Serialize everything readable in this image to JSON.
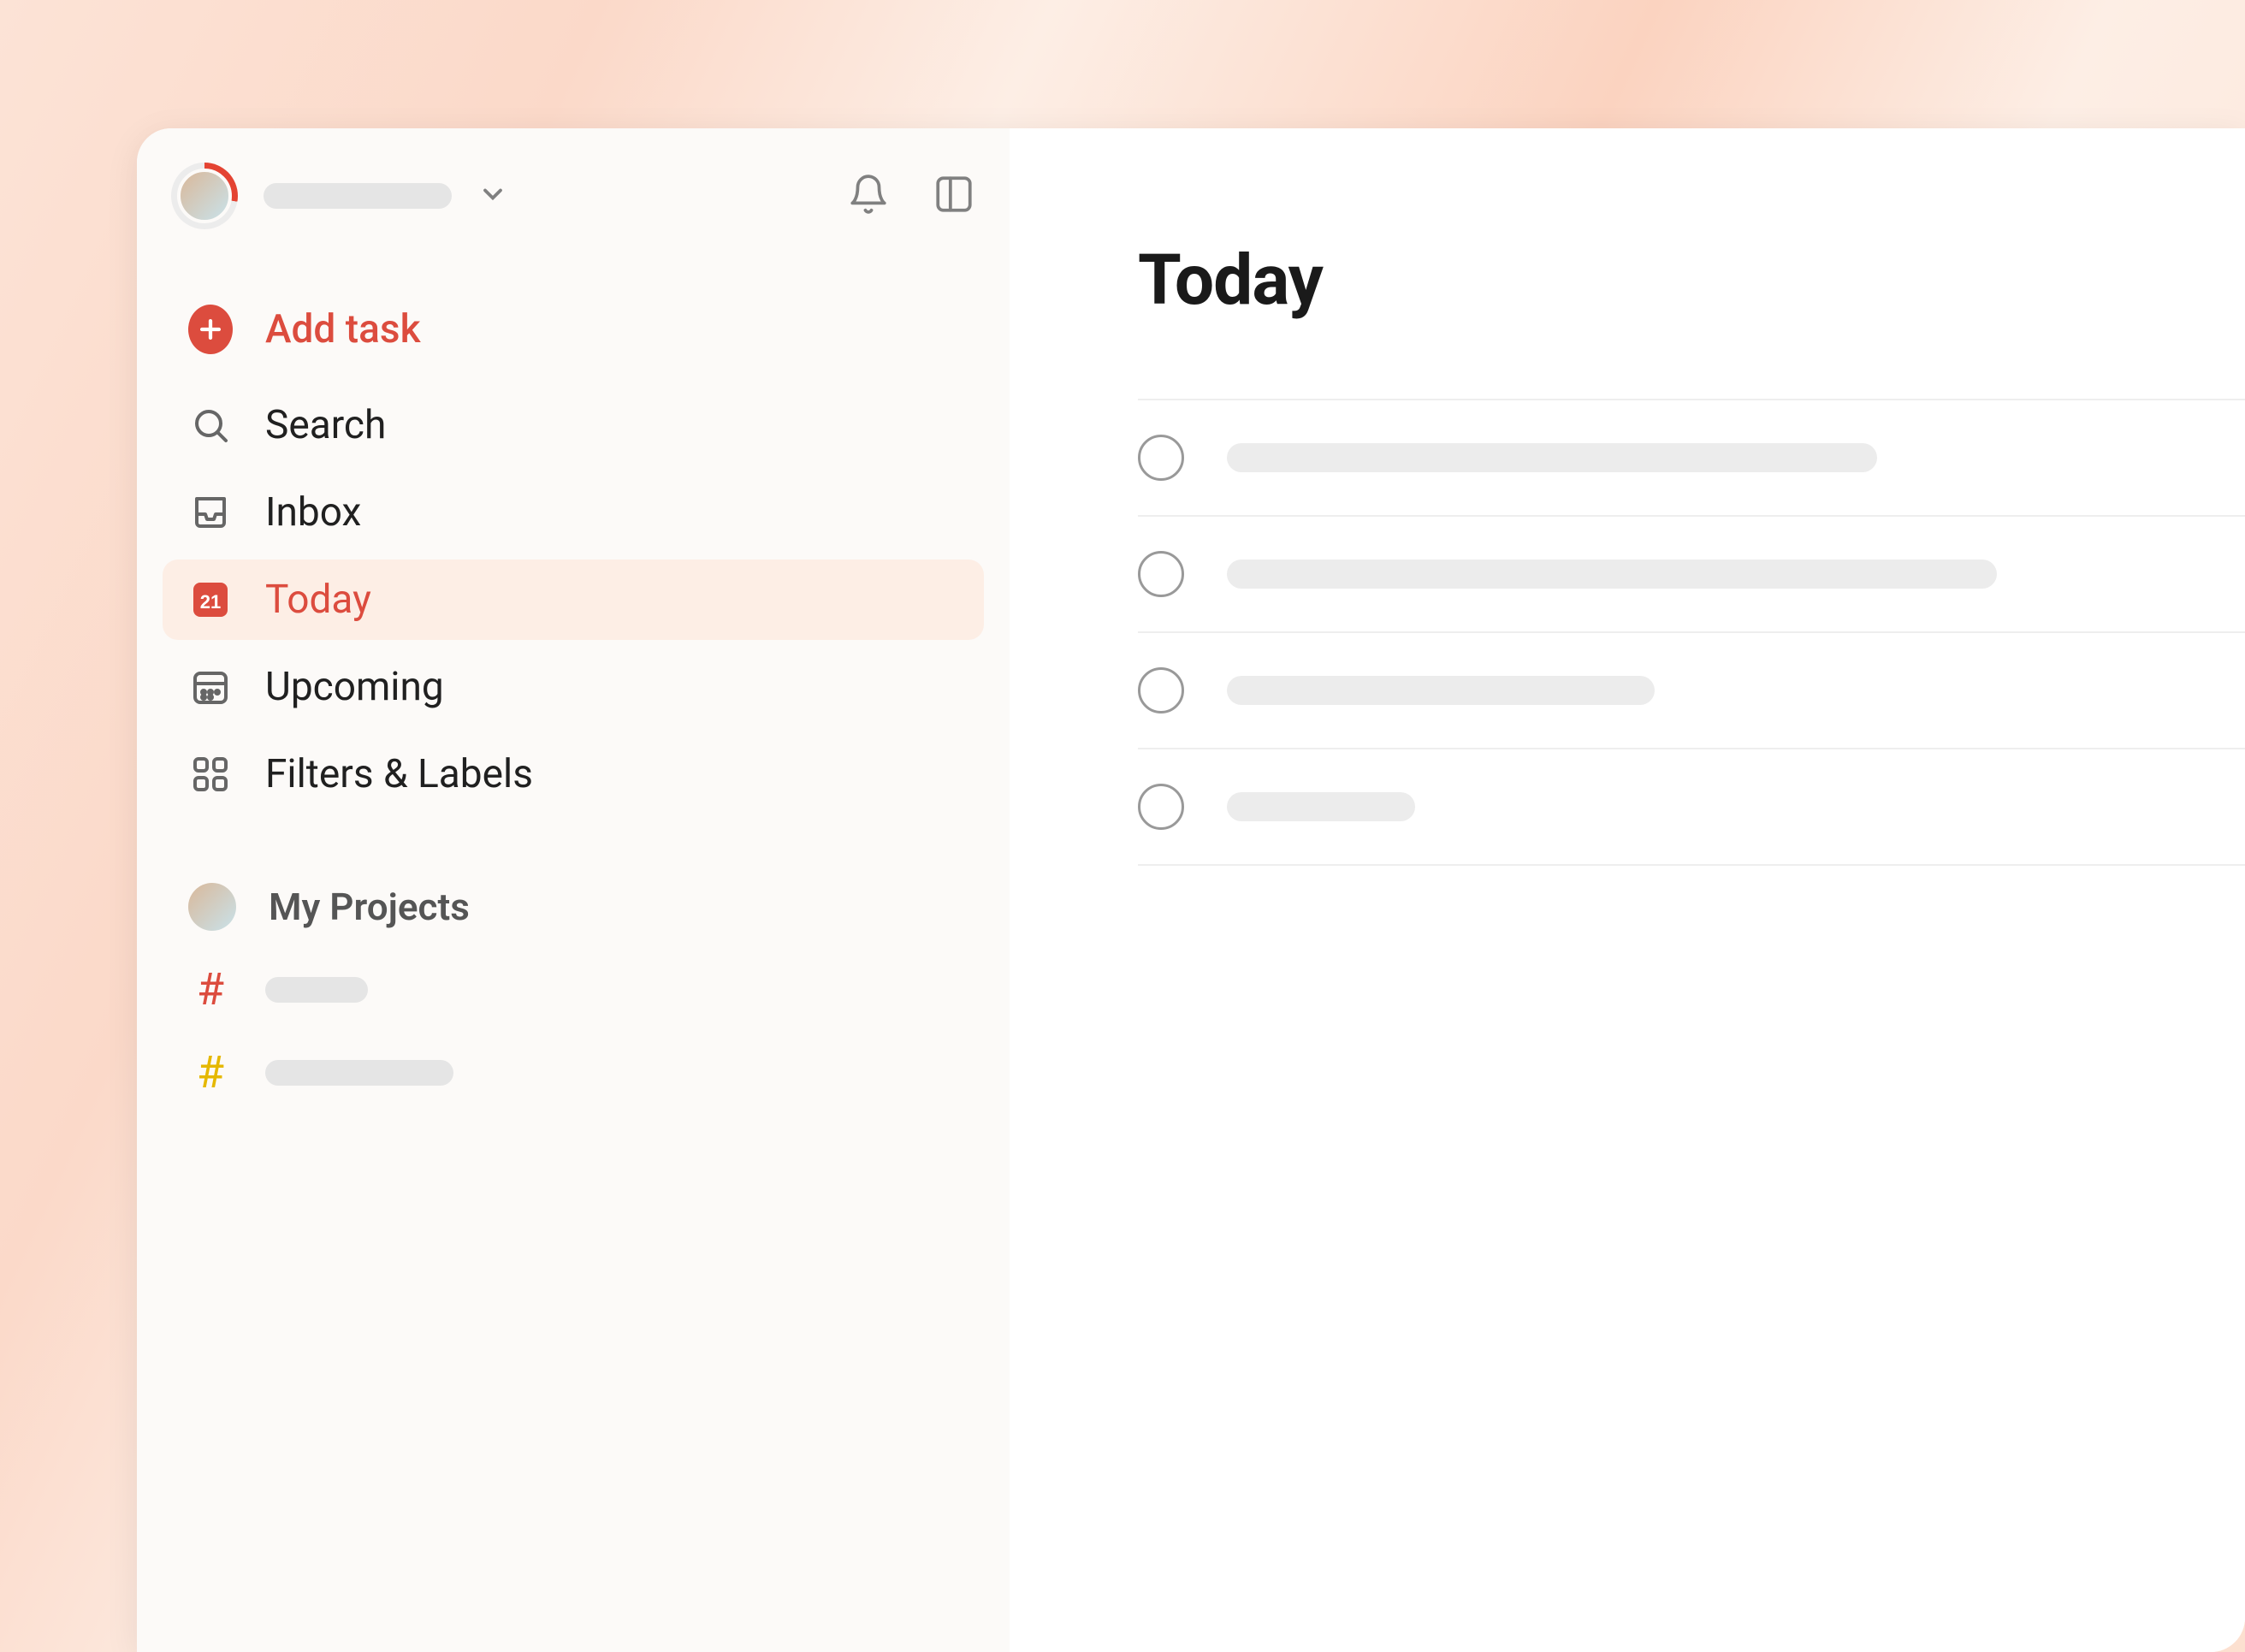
{
  "colors": {
    "accent": "#dc4c3e"
  },
  "sidebar": {
    "add_label": "Add task",
    "nav": {
      "search": "Search",
      "inbox": "Inbox",
      "today": "Today",
      "today_date": "21",
      "upcoming": "Upcoming",
      "filters": "Filters & Labels"
    },
    "projects_header": "My Projects",
    "projects": [
      {
        "color": "#dc4c3e"
      },
      {
        "color": "#e5b800"
      }
    ]
  },
  "main": {
    "title": "Today",
    "tasks": [
      {
        "placeholder_width": 760
      },
      {
        "placeholder_width": 900
      },
      {
        "placeholder_width": 500
      },
      {
        "placeholder_width": 220
      }
    ]
  }
}
